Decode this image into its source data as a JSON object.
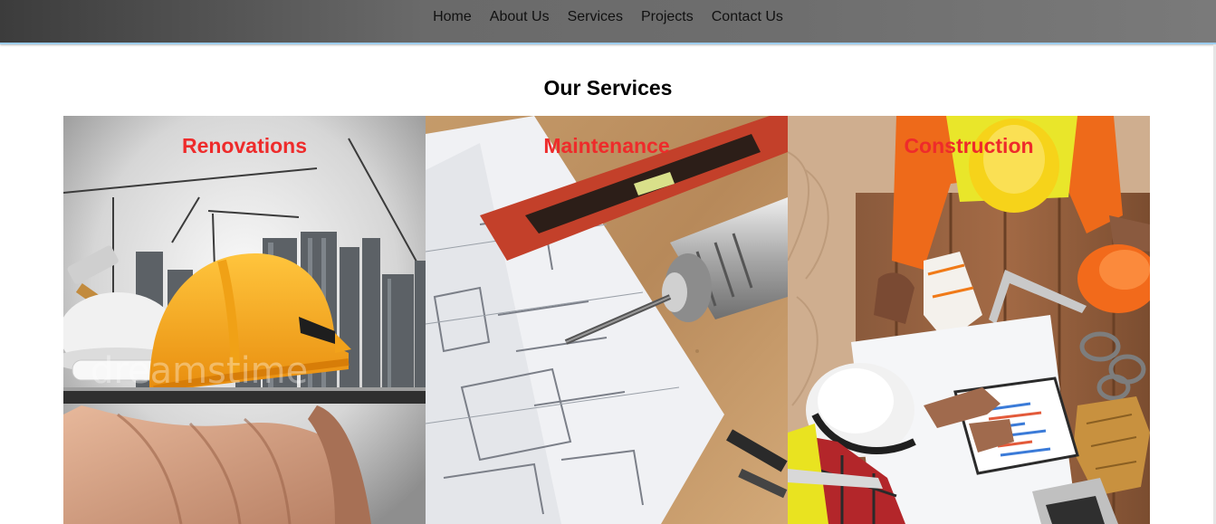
{
  "nav": {
    "items": [
      {
        "label": "Home"
      },
      {
        "label": "About Us"
      },
      {
        "label": "Services"
      },
      {
        "label": "Projects"
      },
      {
        "label": "Contact Us"
      }
    ]
  },
  "services": {
    "title": "Our Services",
    "cards": [
      {
        "title": "Renovations",
        "image": "hard-hat-on-tablet-city-skyline"
      },
      {
        "title": "Maintenance",
        "image": "drill-and-blueprints"
      },
      {
        "title": "Construction",
        "image": "workers-at-table-with-plans"
      }
    ]
  },
  "colors": {
    "nav_background": "#6a6a6a",
    "nav_border": "#9ccdf0",
    "card_title": "#ee2b2b",
    "hard_hat": "#f7a61c"
  }
}
